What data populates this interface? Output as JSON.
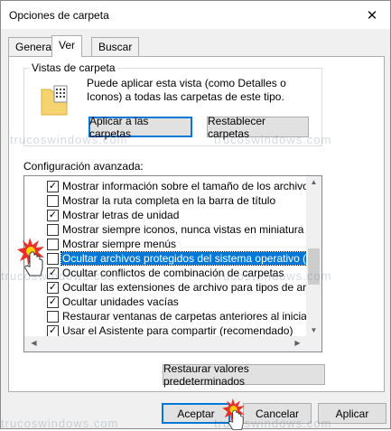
{
  "window": {
    "title": "Opciones de carpeta",
    "close_glyph": "✕"
  },
  "tabs": [
    {
      "label": "General",
      "active": false
    },
    {
      "label": "Ver",
      "active": true
    },
    {
      "label": "Buscar",
      "active": false
    }
  ],
  "folder_views": {
    "group_label": "Vistas de carpeta",
    "description": "Puede aplicar esta vista (como Detalles o Iconos) a todas las carpetas de este tipo.",
    "apply_button": "Aplicar a las carpetas",
    "reset_button": "Restablecer carpetas"
  },
  "advanced": {
    "label": "Configuración avanzada:",
    "items": [
      {
        "label": "Mostrar información sobre el tamaño de los archivos en su",
        "checked": true,
        "selected": false
      },
      {
        "label": "Mostrar la ruta completa en la barra de título",
        "checked": false,
        "selected": false
      },
      {
        "label": "Mostrar letras de unidad",
        "checked": true,
        "selected": false
      },
      {
        "label": "Mostrar siempre iconos, nunca vistas en miniatura",
        "checked": false,
        "selected": false
      },
      {
        "label": "Mostrar siempre menús",
        "checked": false,
        "selected": false
      },
      {
        "label": "Ocultar archivos protegidos del sistema operativo (recome",
        "checked": false,
        "selected": true
      },
      {
        "label": "Ocultar conflictos de combinación de carpetas",
        "checked": true,
        "selected": false
      },
      {
        "label": "Ocultar las extensiones de archivo para tipos de archivo c",
        "checked": true,
        "selected": false
      },
      {
        "label": "Ocultar unidades vacías",
        "checked": true,
        "selected": false
      },
      {
        "label": "Restaurar ventanas de carpetas anteriores al iniciar sesió",
        "checked": false,
        "selected": false
      },
      {
        "label": "Usar el Asistente para compartir (recomendado)",
        "checked": true,
        "selected": false
      }
    ],
    "restore_defaults_button": "Restaurar valores predeterminados"
  },
  "footer": {
    "ok_button": "Aceptar",
    "cancel_button": "Cancelar",
    "apply_button": "Aplicar"
  },
  "watermark_text": "trucoswindows.com",
  "icons": {
    "folder": "folder-grid-icon",
    "close": "close-icon",
    "check": "checkmark-icon",
    "cursor": "hand-pointer-icon"
  },
  "colors": {
    "selection": "#0078d7",
    "folder_yellow": "#f5d46f",
    "burst_red": "#e8312a",
    "burst_yellow": "#ffd200"
  }
}
